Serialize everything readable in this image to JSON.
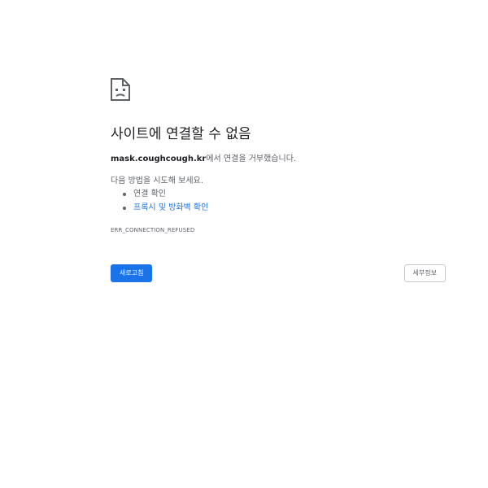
{
  "error": {
    "icon": "sad-page-icon",
    "headline": "사이트에 연결할 수 없음",
    "host": "mask.coughcough.kr",
    "description_suffix": "에서 연결을 거부했습니다.",
    "try_label": "다음 방법을 시도해 보세요.",
    "suggestions": [
      {
        "label": "연결 확인",
        "is_link": false
      },
      {
        "label": "프록시 및 방화벽 확인",
        "is_link": true
      }
    ],
    "code": "ERR_CONNECTION_REFUSED"
  },
  "buttons": {
    "reload_label": "새로고침",
    "details_label": "세부정보"
  },
  "colors": {
    "primary": "#1a73e8",
    "text": "#202124",
    "secondary_text": "#5f6368"
  }
}
